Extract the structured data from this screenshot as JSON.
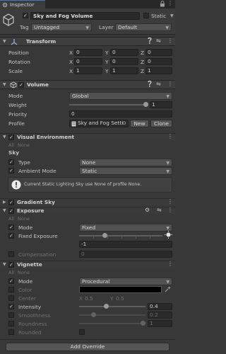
{
  "tab": {
    "label": "Inspector"
  },
  "gameobject": {
    "name": "Sky and Fog Volume",
    "static_label": "Static",
    "tag_label": "Tag",
    "tag_value": "Untagged",
    "layer_label": "Layer",
    "layer_value": "Default"
  },
  "transform": {
    "title": "Transform",
    "rows": [
      {
        "label": "Position",
        "x": "0",
        "y": "0",
        "z": "0"
      },
      {
        "label": "Rotation",
        "x": "0",
        "y": "0",
        "z": "0"
      },
      {
        "label": "Scale",
        "x": "1",
        "y": "1",
        "z": "1"
      }
    ],
    "axis_x": "X",
    "axis_y": "Y",
    "axis_z": "Z"
  },
  "volume": {
    "title": "Volume",
    "mode_label": "Mode",
    "mode_value": "Global",
    "weight_label": "Weight",
    "weight_value": "1",
    "weight_fraction": 1.0,
    "priority_label": "Priority",
    "priority_value": "0",
    "profile_label": "Profile",
    "profile_value": "Sky and Fog Setti",
    "new_button": "New",
    "clone_button": "Clone"
  },
  "visual_environment": {
    "title": "Visual Environment",
    "all": "All",
    "none": "None",
    "sky_label": "Sky",
    "type_label": "Type",
    "type_value": "None",
    "ambient_label": "Ambient Mode",
    "ambient_value": "Static",
    "help_text": "Current Static Lighting Sky use None of profile None."
  },
  "gradient_sky": {
    "title": "Gradient Sky"
  },
  "exposure": {
    "title": "Exposure",
    "all": "All",
    "none": "None",
    "mode_label": "Mode",
    "mode_value": "Fixed",
    "fixed_label": "Fixed Exposure",
    "fixed_value": "-1",
    "compensation_label": "Compensation",
    "compensation_value": "0"
  },
  "vignette": {
    "title": "Vignette",
    "all": "All",
    "none": "None",
    "mode_label": "Mode",
    "mode_value": "Procedural",
    "color_label": "Color",
    "center_label": "Center",
    "center_x": "0.5",
    "center_y": "0.5",
    "axis_x": "X",
    "axis_y": "Y",
    "intensity_label": "Intensity",
    "intensity_value": "0.4",
    "intensity_fraction": 0.4,
    "smoothness_label": "Smoothness",
    "smoothness_value": "0.2",
    "smoothness_fraction": 0.2,
    "roundness_label": "Roundness",
    "roundness_value": "1",
    "roundness_fraction": 1.0,
    "rounded_label": "Rounded",
    "color_value": "#000000"
  },
  "add_override_button": "Add Override",
  "colors": {
    "accent": "#3a79bb",
    "background": "#383838"
  }
}
